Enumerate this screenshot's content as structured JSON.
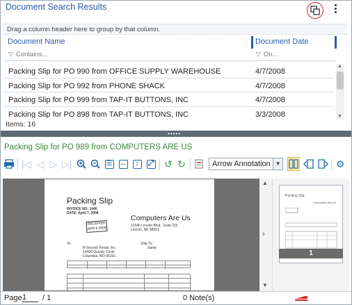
{
  "header": {
    "title": "Document Search Results"
  },
  "group_hint": "Drag a column header here to group by that column.",
  "columns": [
    {
      "label": "Document Name",
      "filter_placeholder": "Contains..."
    },
    {
      "label": "Document Date",
      "filter_placeholder": "On..."
    }
  ],
  "rows": [
    {
      "name": "Packing Slip for PO 990 from OFFICE SUPPLY WAREHOUSE",
      "date": "4/7/2008"
    },
    {
      "name": "Packing Slip for PO 992 from PHONE SHACK",
      "date": "4/7/2008"
    },
    {
      "name": "Packing Slip for PO 999 from TAP-IT BUTTONS, INC",
      "date": "4/7/2008"
    },
    {
      "name": "Packing Slip for PO 898 from TAP-IT BUTTONS, INC",
      "date": "3/3/2008"
    }
  ],
  "items_count": "Items: 16",
  "viewer": {
    "doc_title": "Packing Slip for PO 989 from COMPUTERS ARE US",
    "annotation_select": "Arrow Annotation",
    "page": {
      "title": "Packing Slip",
      "invoice": "INVOICE NO: 1440",
      "date": "DATE: April 7, 2008",
      "company": "Computers Are Us",
      "address1": "12340 Lincoln Blvd., Suite 225",
      "address2": "Lincoln, NE 68501",
      "stamp": "RECEIVED APR 8 2008",
      "to_label": "To:",
      "to1": "B-Second Foods, Inc.",
      "to2": "19000 Quickly Circle",
      "to3": "Columbia, MO 65201",
      "ship_to": "Ship To:",
      "ship_same": "Same"
    },
    "thumbnail_number": "1"
  },
  "status": {
    "page_label": "Page",
    "page_value": "1",
    "page_of": "/ 1",
    "notes": "0 Note(s)"
  },
  "colors": {
    "accent": "#2d5aa8",
    "title_green": "#3a8a3a",
    "highlight_circle": "#d62020"
  }
}
